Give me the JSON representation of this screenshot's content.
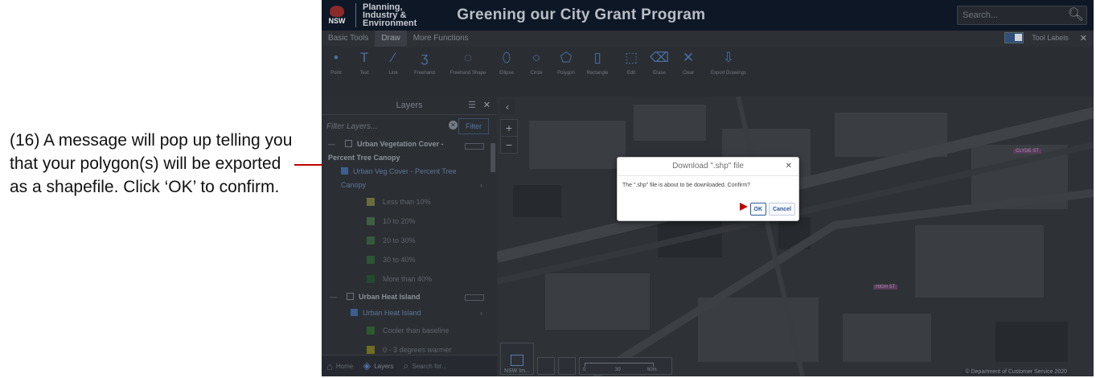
{
  "instruction": "(16) A message will pop up telling you that your polygon(s) will be exported as a shapefile. Click ‘OK’ to confirm.",
  "header": {
    "logo_text": "NSW",
    "agency_lines": [
      "Planning,",
      "Industry &",
      "Environment"
    ],
    "title": "Greening our City Grant Program",
    "search_placeholder": "Search..."
  },
  "tabs": [
    "Basic Tools",
    "Draw",
    "More Functions"
  ],
  "active_tab": "Draw",
  "tool_labels": "Tool Labels",
  "tools": [
    {
      "label": "Point",
      "icon": "point-icon",
      "glyph": "•"
    },
    {
      "label": "Text",
      "icon": "text-icon",
      "glyph": "T"
    },
    {
      "label": "Line",
      "icon": "line-icon",
      "glyph": "⁄"
    },
    {
      "label": "Freehand",
      "icon": "freehand-icon",
      "glyph": "ʒ"
    },
    {
      "label": "Freehand Shape",
      "icon": "freehand-shape-icon",
      "glyph": "◌"
    },
    {
      "label": "Ellipse",
      "icon": "ellipse-icon",
      "glyph": "⬯"
    },
    {
      "label": "Circle",
      "icon": "circle-icon",
      "glyph": "○"
    },
    {
      "label": "Polygon",
      "icon": "polygon-icon",
      "glyph": "⬠"
    },
    {
      "label": "Rectangle",
      "icon": "rectangle-icon",
      "glyph": "▯"
    },
    {
      "label": "Edit",
      "icon": "edit-icon",
      "glyph": "⬚"
    },
    {
      "label": "Erase",
      "icon": "erase-icon",
      "glyph": "⌫"
    },
    {
      "label": "Clear",
      "icon": "clear-icon",
      "glyph": "✕"
    },
    {
      "label": "Export Drawings",
      "icon": "export-drawings-icon",
      "glyph": "⇩"
    }
  ],
  "layers_panel": {
    "title": "Layers",
    "filter_placeholder": "Filter Layers...",
    "filter_button": "Filter",
    "groups": [
      {
        "name": "Urban Vegetation Cover - Percent Tree Canopy",
        "sublayer": "Urban Veg Cover - Percent Tree Canopy",
        "legend": [
          {
            "label": "Less than 10%",
            "color": "#6b6d3e"
          },
          {
            "label": "10 to 20%",
            "color": "#3f5f43"
          },
          {
            "label": "20 to 30%",
            "color": "#355a3b"
          },
          {
            "label": "30 to 40%",
            "color": "#2d5434"
          },
          {
            "label": "More than 40%",
            "color": "#24492c"
          }
        ]
      },
      {
        "name": "Urban Heat Island",
        "sublayer": "Urban Heat Island",
        "legend": [
          {
            "label": "Cooler than baseline",
            "color": "#2d5a2d"
          },
          {
            "label": "0 - 3 degrees warmer",
            "color": "#6e6e20"
          }
        ]
      }
    ]
  },
  "bottom_tabs": [
    {
      "label": "Home",
      "icon": "home-icon"
    },
    {
      "label": "Layers",
      "icon": "layers-icon"
    },
    {
      "label": "Search for...",
      "icon": "search-for-icon"
    }
  ],
  "map": {
    "basemap_label": "NSW Im...",
    "scale_labels": [
      "0",
      "30",
      "60m"
    ],
    "attribution": "© Department of Customer Service 2020",
    "labels": [
      "CLYDE ST",
      "HIGH ST"
    ]
  },
  "dialog": {
    "title": "Download \".shp\" file",
    "message": "The \".shp\" file is about to be downloaded. Confirm?",
    "ok": "OK",
    "cancel": "Cancel"
  },
  "colors": {
    "callout": "#c00000",
    "accent": "#2f5d9c"
  }
}
